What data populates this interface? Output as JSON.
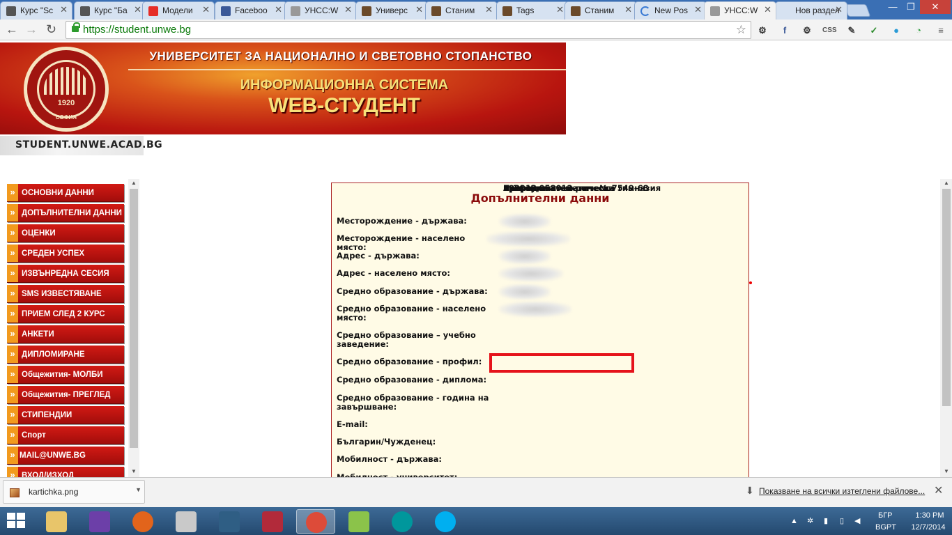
{
  "browser": {
    "tabs": [
      {
        "label": "Курс \"Sc",
        "icon": "puzzle-icon",
        "color": "#555555"
      },
      {
        "label": "Курс \"Ба",
        "icon": "puzzle-icon",
        "color": "#555555"
      },
      {
        "label": "Модели",
        "icon": "youtube-icon",
        "color": "#e52d27"
      },
      {
        "label": "Faceboo",
        "icon": "facebook-icon",
        "color": "#3b5998"
      },
      {
        "label": "УНСС:W",
        "icon": "page-icon",
        "color": "#999999"
      },
      {
        "label": "Универс",
        "icon": "site-icon",
        "color": "#6b4a2a"
      },
      {
        "label": "Станим",
        "icon": "site-icon",
        "color": "#6b4a2a"
      },
      {
        "label": "Tags",
        "icon": "site-icon",
        "color": "#6b4a2a"
      },
      {
        "label": "Станим",
        "icon": "site-icon",
        "color": "#6b4a2a"
      },
      {
        "label": "New Pos",
        "icon": "loading-icon",
        "color": "#3b7bd4"
      },
      {
        "label": "УНСС:W",
        "icon": "page-icon",
        "color": "#999999",
        "active": true
      },
      {
        "label": "Нов раздел",
        "icon": "none",
        "color": "#ffffff"
      }
    ],
    "url": "https://student.unwe.bg",
    "extensions": [
      "settings-icon",
      "fb-icon",
      "gear-icon",
      "css",
      "eyedropper-icon",
      "abc-check-icon",
      "drop-icon",
      "timer-icon",
      "menu-icon"
    ]
  },
  "header": {
    "university": "УНИВЕРСИТЕТ ЗА НАЦИОНАЛНО И СВЕТОВНО СТОПАНСТВО",
    "system": "ИНФОРМАЦИОННА СИСТЕМА",
    "product": "WEB-СТУДЕНТ",
    "emblem_year": "1920",
    "emblem_city": "СОФИЯ",
    "domain": "STUDENT.UNWE.ACAD.BG"
  },
  "menu": [
    "ОСНОВНИ ДАННИ",
    "ДОПЪЛНИТЕЛНИ ДАННИ",
    "ОЦЕНКИ",
    "СРЕДЕН УСПЕХ",
    "ИЗВЪНРЕДНА СЕСИЯ",
    "SMS ИЗВЕСТЯВАНЕ",
    "ПРИЕМ СЛЕД 2 КУРС",
    "АНКЕТИ",
    "ДИПЛОМИРАНЕ",
    "Общежития- МОЛБИ",
    "Общежития- ПРЕГЛЕД",
    "СТИПЕНДИИ",
    "Спорт",
    "MAIL@UNWE.BG",
    "ВХОД/ИЗХОД"
  ],
  "panel": {
    "title": "Допълнителни данни",
    "rows": [
      {
        "label": "Месторождение - държава:",
        "value": ""
      },
      {
        "label": "Месторождение - населено място:",
        "value": ""
      },
      {
        "label": "Адрес - държава:",
        "value": ""
      },
      {
        "label": "Адрес - населено място:",
        "value": ""
      },
      {
        "label": "Средно образование - държава:",
        "value": ""
      },
      {
        "label": "Средно образование - населено място:",
        "value": ""
      },
      {
        "label": "Средно образование – учебно заведение:",
        "value": "Природоматематическа гимназия"
      },
      {
        "label": "Средно образование - профил:",
        "value": "преродоматеметически"
      },
      {
        "label": "Средно образование - диплома:",
        "value": "А-14 № 058012 рег . № 7549-68"
      },
      {
        "label": "Средно образование - година на завършване:",
        "value": "192013г."
      },
      {
        "label": "E-mail:",
        "value": ""
      },
      {
        "label": "Българин/Чужденец:",
        "value": "Българин"
      },
      {
        "label": "Мобилност - държава:",
        "value": ""
      },
      {
        "label": "Мобилност - университет:",
        "value": ""
      }
    ]
  },
  "downloads": {
    "file": "kartichka.png",
    "show_all": "Показване на всички изтеглени файлове..."
  },
  "taskbar": {
    "apps": [
      "file-explorer-icon",
      "visual-studio-icon",
      "firefox-icon",
      "tools-icon",
      "mysql-icon",
      "alarm-icon",
      "chrome-icon",
      "android-icon",
      "arduino-icon",
      "skype-icon"
    ],
    "active_app": "chrome-icon",
    "lang": "БГР",
    "layout": "BGPT",
    "time": "1:30 PM",
    "date": "12/7/2014"
  }
}
